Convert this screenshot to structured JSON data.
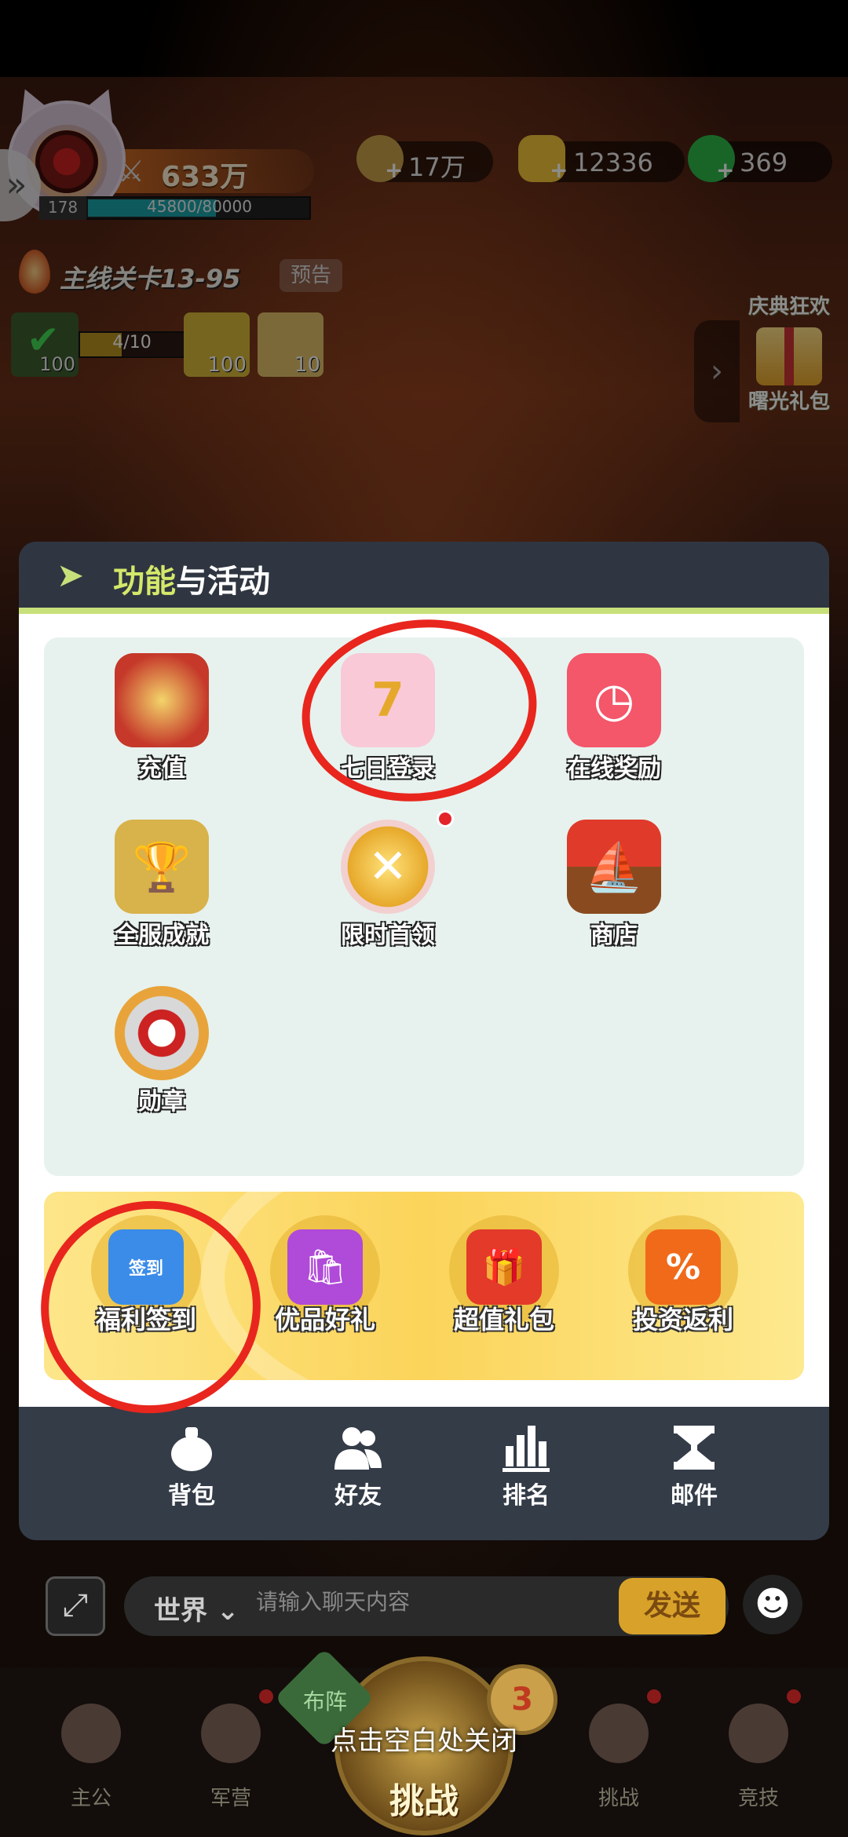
{
  "player": {
    "level": "178",
    "power": "633万",
    "exp_text": "45800/80000",
    "exp_ratio": 0.5725
  },
  "resources": [
    {
      "name": "coins",
      "value": "17万",
      "icon": "copper-coin-icon",
      "color": "#d4a84a"
    },
    {
      "name": "gold-ingots",
      "value": "12336",
      "icon": "gold-ingot-icon",
      "color": "#f2c53a"
    },
    {
      "name": "jade",
      "value": "369",
      "icon": "jade-icon",
      "color": "#2eb84a"
    }
  ],
  "quest": {
    "title": "主线关卡13-95",
    "preview_label": "预告",
    "progress_text": "4/10",
    "progress_ratio": 0.4,
    "check_count": "100",
    "rewards": [
      "100",
      "10"
    ]
  },
  "right_events": {
    "top_label": "庆典狂欢",
    "gift_label": "曙光礼包"
  },
  "modal": {
    "title_highlight": "功能",
    "title_rest": "与活动",
    "functions": [
      {
        "label": "充值",
        "icon": "money-bag-icon",
        "symbol": "💰",
        "bg": "#e7f2ee"
      },
      {
        "label": "七日登录",
        "icon": "seven-day-calendar-icon",
        "symbol": "7",
        "bg": "#f9c9d8"
      },
      {
        "label": "在线奖励",
        "icon": "online-clock-icon",
        "symbol": "⏰",
        "bg": "#f4566a"
      },
      {
        "label": "全服成就",
        "icon": "trophy-icon",
        "symbol": "🏆",
        "bg": "#d8b24a"
      },
      {
        "label": "限时首领",
        "icon": "limited-boss-icon",
        "symbol": "⚔",
        "bg": "#f3c94a"
      },
      {
        "label": "商店",
        "icon": "dragon-boat-icon",
        "symbol": "⛵",
        "bg": "#e7f2ee"
      },
      {
        "label": "勋章",
        "icon": "medal-icon",
        "symbol": "🏅",
        "bg": "#f0c060"
      }
    ],
    "welfare": [
      {
        "label": "福利签到",
        "icon": "sign-in-calendar-icon",
        "symbol": "签到",
        "bg": "#3a8ce8"
      },
      {
        "label": "优品好礼",
        "icon": "shopping-bag-icon",
        "symbol": "🛍",
        "bg": "#b04ad8"
      },
      {
        "label": "超值礼包",
        "icon": "red-gift-box-icon",
        "symbol": "🎁",
        "bg": "#e33a2a"
      },
      {
        "label": "投资返利",
        "icon": "discount-tag-icon",
        "symbol": "%",
        "bg": "#f06a1a"
      }
    ],
    "footer": [
      {
        "label": "背包",
        "icon": "backpack-icon"
      },
      {
        "label": "好友",
        "icon": "friends-icon"
      },
      {
        "label": "排名",
        "icon": "ranking-icon"
      },
      {
        "label": "邮件",
        "icon": "mail-icon"
      }
    ]
  },
  "chat": {
    "channel": "世界",
    "placeholder": "请输入聊天内容",
    "send_label": "发送"
  },
  "nav": {
    "items": [
      "主公",
      "军营",
      "挑战",
      "竞技"
    ],
    "challenge_label": "挑战",
    "formation_label": "布阵",
    "stamina": "3"
  },
  "close_hint": "点击空白处关闭"
}
